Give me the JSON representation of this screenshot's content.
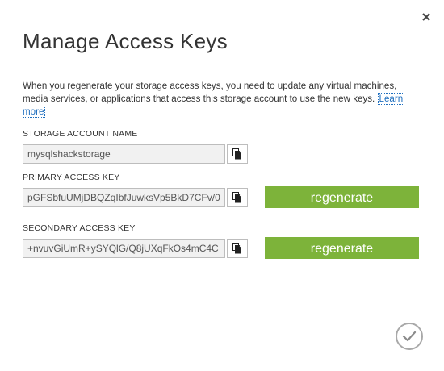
{
  "dialog": {
    "title": "Manage Access Keys",
    "description": "When you regenerate your storage access keys, you need to update any virtual machines, media services, or applications that access this storage account to use the new keys.",
    "learn_more": "Learn more"
  },
  "storage_account": {
    "label": "STORAGE ACCOUNT NAME",
    "value": "mysqlshackstorage"
  },
  "primary_key": {
    "label": "PRIMARY ACCESS KEY",
    "value": "pGFSbfuUMjDBQZqIbfJuwksVp5BkD7CFv/0",
    "regenerate_label": "regenerate"
  },
  "secondary_key": {
    "label": "SECONDARY ACCESS KEY",
    "value": "+nvuvGiUmR+ySYQlG/Q8jUXqFkOs4mC4C",
    "regenerate_label": "regenerate"
  },
  "colors": {
    "accent_green": "#7db33a",
    "link_blue": "#1f6fbf"
  },
  "icons": {
    "close": "close-icon",
    "copy": "copy-icon",
    "ok": "checkmark-icon"
  }
}
